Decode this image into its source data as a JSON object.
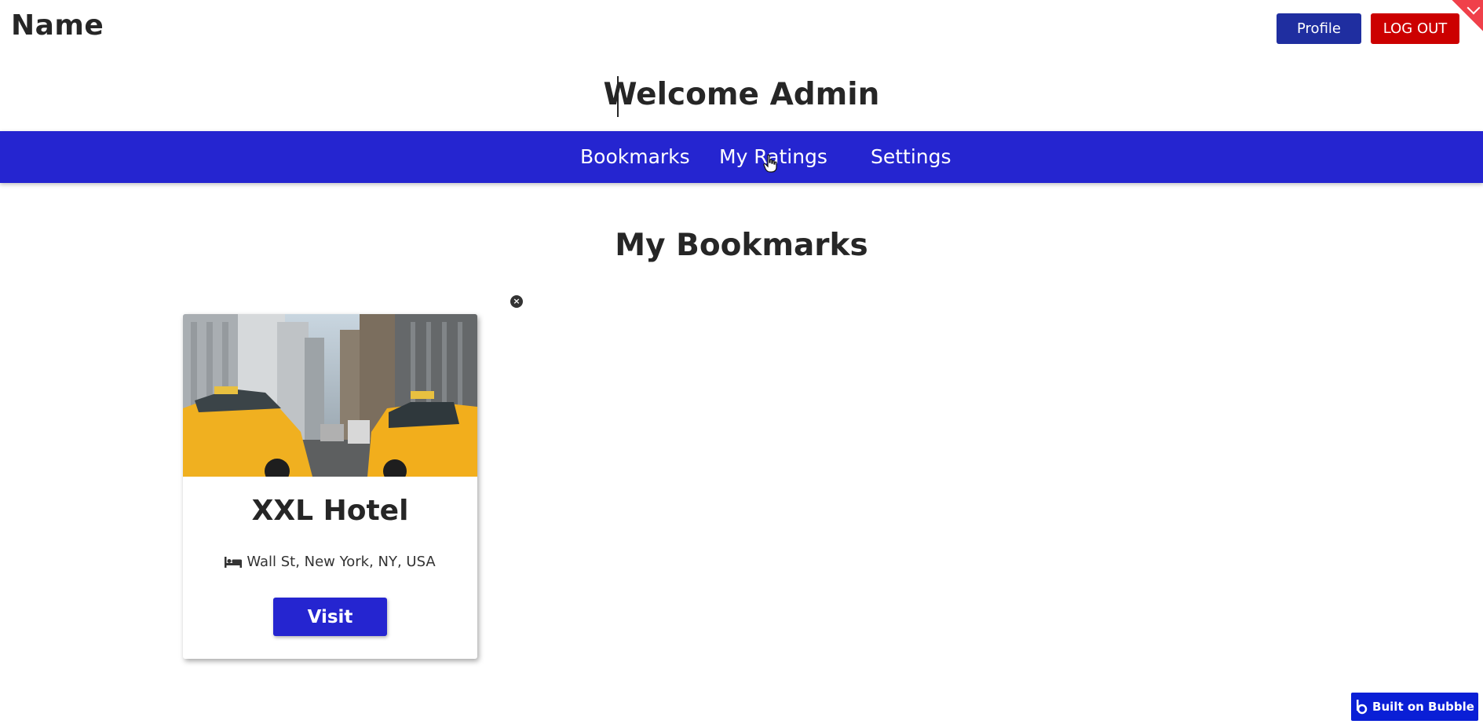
{
  "header": {
    "brand": "Name",
    "profile_label": "Profile",
    "logout_label": "LOG OUT"
  },
  "welcome": "Welcome Admin",
  "nav": {
    "items": [
      {
        "label": "Bookmarks"
      },
      {
        "label": "My Ratings"
      },
      {
        "label": "Settings"
      }
    ]
  },
  "main": {
    "section_title": "My Bookmarks",
    "cards": [
      {
        "title": "XXL Hotel",
        "address": "Wall St, New York, NY, USA",
        "visit_label": "Visit",
        "image_icon": "city-street-taxi-photo"
      }
    ]
  },
  "badge": {
    "label": "Built on Bubble"
  },
  "colors": {
    "nav_bar": "#2525d0",
    "profile_button": "#1f2ea0",
    "logout_button": "#cc0000",
    "visit_button": "#2525d0",
    "bubble_badge": "#0a1fd6",
    "corner_tab": "#f0404a"
  }
}
